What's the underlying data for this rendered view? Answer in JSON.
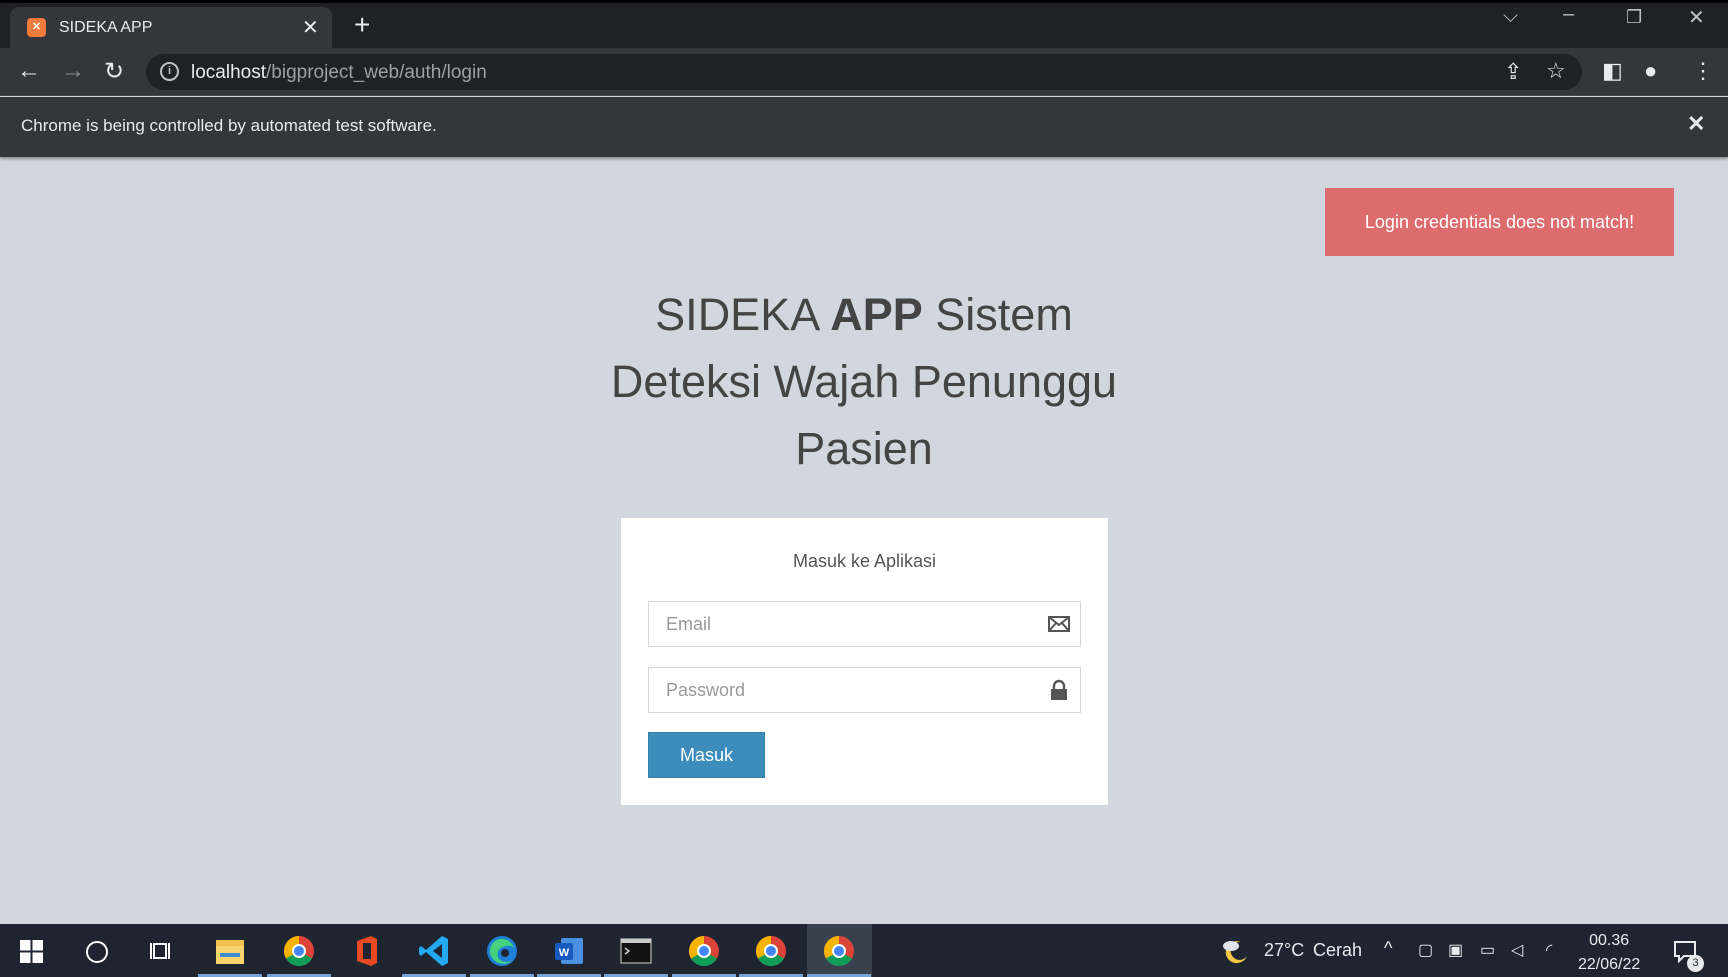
{
  "browser": {
    "tab_title": "SIDEKA APP",
    "favicon_text": "ဢ",
    "url_host": "localhost",
    "url_path": "/bigproject_web/auth/login",
    "infobar_message": "Chrome is being controlled by automated test software."
  },
  "page": {
    "alert": "Login credentials does not match!",
    "hero_line1_a": "SIDEKA ",
    "hero_line1_b": "APP",
    "hero_line1_c": " Sistem",
    "hero_line2": "Deteksi Wajah Penunggu",
    "hero_line3": "Pasien",
    "form_caption": "Masuk ke Aplikasi",
    "email_placeholder": "Email",
    "password_placeholder": "Password",
    "submit_label": "Masuk"
  },
  "taskbar": {
    "weather_temp": "27°C",
    "weather_desc": "Cerah",
    "time": "00.36",
    "date": "22/06/22",
    "notification_count": "3"
  },
  "colors": {
    "alert_bg": "#dd6c6e",
    "button_bg": "#3c8dbc",
    "page_bg": "#d2d6de"
  }
}
